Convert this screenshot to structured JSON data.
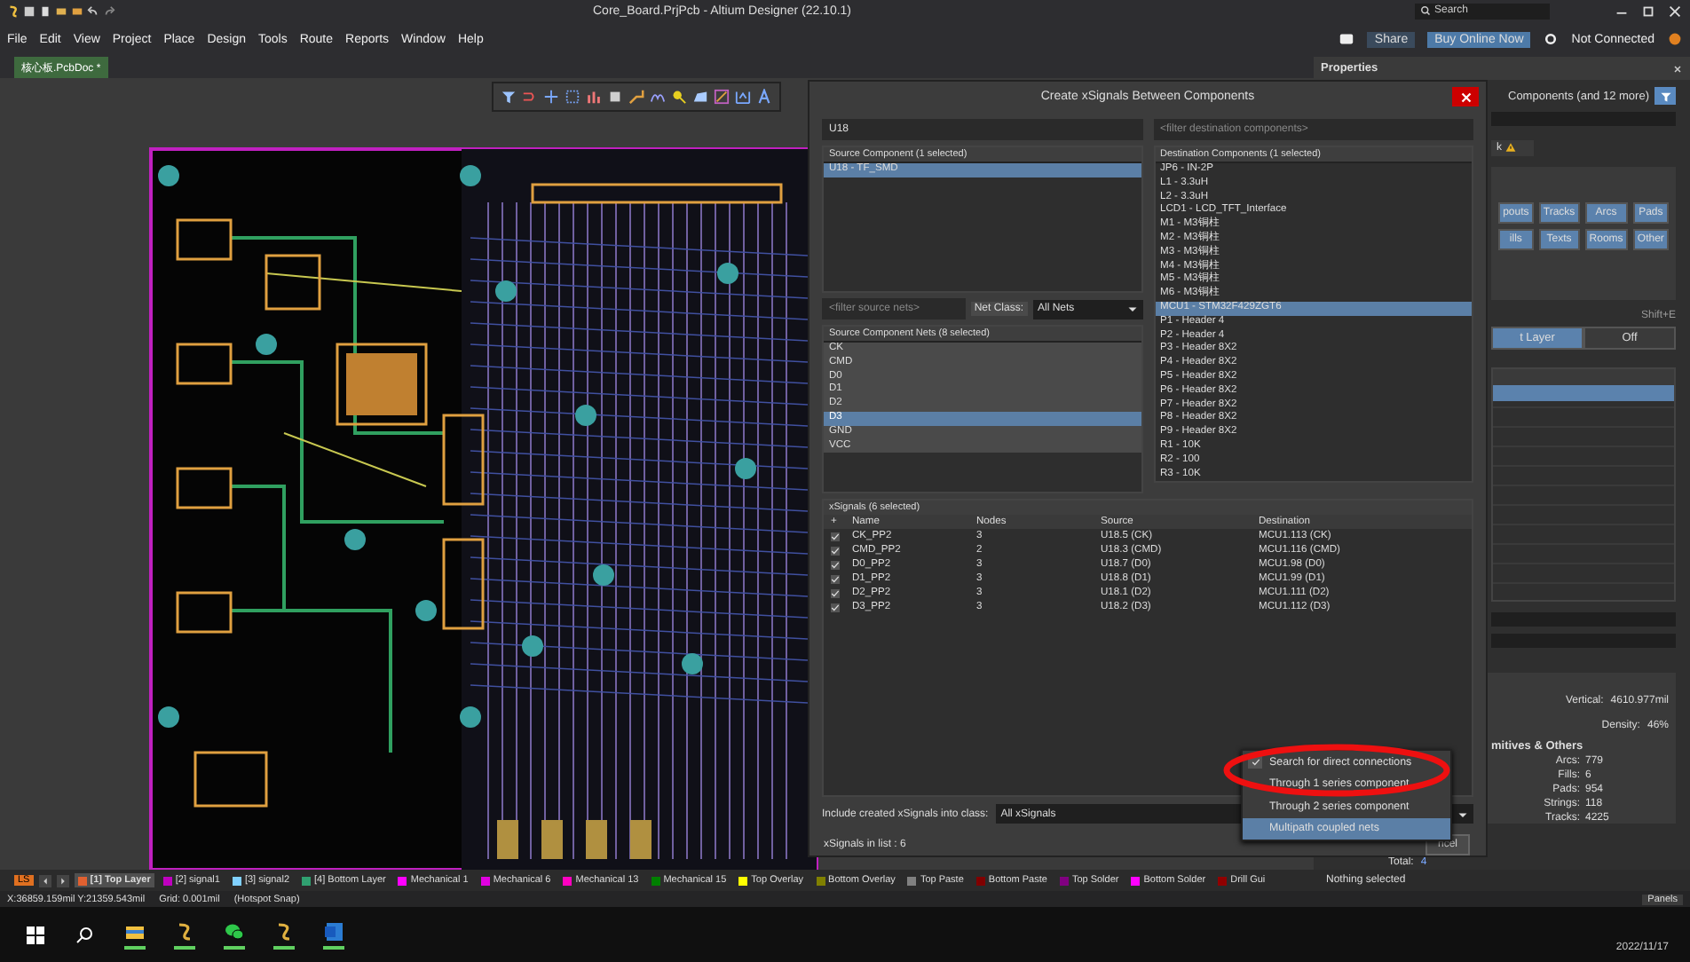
{
  "window": {
    "title": "Core_Board.PrjPcb - Altium Designer (22.10.1)",
    "search_placeholder": "Search"
  },
  "menu": [
    "File",
    "Edit",
    "View",
    "Project",
    "Place",
    "Design",
    "Tools",
    "Route",
    "Reports",
    "Window",
    "Help"
  ],
  "header_actions": {
    "share": "Share",
    "buy": "Buy Online Now",
    "connection": "Not Connected"
  },
  "document_tabs": [
    {
      "label": "核心板.PcbDoc *",
      "selected": true
    }
  ],
  "properties": {
    "title": "Properties",
    "filter": "Components (and 12 more)",
    "tab_fragment": "k",
    "object_buttons": [
      {
        "label": "pouts",
        "selected": true
      },
      {
        "label": "Tracks",
        "selected": true
      },
      {
        "label": "Arcs",
        "selected": true
      },
      {
        "label": "Pads",
        "selected": true
      },
      {
        "label": "ills",
        "selected": true
      },
      {
        "label": "Texts",
        "selected": true
      },
      {
        "label": "Rooms",
        "selected": true
      },
      {
        "label": "Other",
        "selected": true
      }
    ],
    "shortcut": "Shift+E",
    "layer_toggle": [
      {
        "label": "t Layer",
        "selected": true
      },
      {
        "label": "Off",
        "selected": false
      }
    ],
    "vertical_label": "Vertical:",
    "vertical": "4610.977mil",
    "density_label": "Density:",
    "density": "46%",
    "section": "mitives & Others",
    "stats": [
      {
        "label": "Arcs:",
        "value": "779"
      },
      {
        "label": "Fills:",
        "value": "6"
      },
      {
        "label": "Pads:",
        "value": "954"
      },
      {
        "label": "Strings:",
        "value": "118"
      },
      {
        "label": "Tracks:",
        "value": "4225"
      }
    ],
    "total_label": "Total:",
    "total": "4"
  },
  "dialog": {
    "title": "Create xSignals Between Components",
    "source_filter": "U18",
    "source_header": "Source Component (1 selected)",
    "source_components": [
      {
        "label": "U18 - TF_SMD",
        "selected": true
      }
    ],
    "nets_filter_placeholder": "<filter source nets>",
    "net_class_label": "Net Class:",
    "net_class": "All Nets",
    "nets_header": "Source Component Nets (8 selected)",
    "nets": [
      {
        "label": "CK",
        "selected": true,
        "current": false
      },
      {
        "label": "CMD",
        "selected": true,
        "current": false
      },
      {
        "label": "D0",
        "selected": true,
        "current": false
      },
      {
        "label": "D1",
        "selected": true,
        "current": false
      },
      {
        "label": "D2",
        "selected": true,
        "current": false
      },
      {
        "label": "D3",
        "selected": true,
        "current": true
      },
      {
        "label": "GND",
        "selected": true,
        "current": false
      },
      {
        "label": "VCC",
        "selected": true,
        "current": false
      }
    ],
    "dest_filter_placeholder": "<filter destination components>",
    "dest_header": "Destination Components (1 selected)",
    "destinations": [
      {
        "label": "JP6 - IN-2P",
        "selected": false
      },
      {
        "label": "L1 - 3.3uH",
        "selected": false
      },
      {
        "label": "L2 - 3.3uH",
        "selected": false
      },
      {
        "label": "LCD1 - LCD_TFT_Interface",
        "selected": false
      },
      {
        "label": "M1 - M3铜柱",
        "selected": false
      },
      {
        "label": "M2 - M3铜柱",
        "selected": false
      },
      {
        "label": "M3 - M3铜柱",
        "selected": false
      },
      {
        "label": "M4 - M3铜柱",
        "selected": false
      },
      {
        "label": "M5 - M3铜柱",
        "selected": false
      },
      {
        "label": "M6 - M3铜柱",
        "selected": false
      },
      {
        "label": "MCU1 - STM32F429ZGT6",
        "selected": true
      },
      {
        "label": "P1 - Header 4",
        "selected": false
      },
      {
        "label": "P2 - Header 4",
        "selected": false
      },
      {
        "label": "P3 - Header 8X2",
        "selected": false
      },
      {
        "label": "P4 - Header 8X2",
        "selected": false
      },
      {
        "label": "P5 - Header 8X2",
        "selected": false
      },
      {
        "label": "P6 - Header 8X2",
        "selected": false
      },
      {
        "label": "P7 - Header 8X2",
        "selected": false
      },
      {
        "label": "P8 - Header 8X2",
        "selected": false
      },
      {
        "label": "P9 - Header 8X2",
        "selected": false
      },
      {
        "label": "R1 - 10K",
        "selected": false
      },
      {
        "label": "R2 - 100",
        "selected": false
      },
      {
        "label": "R3 - 10K",
        "selected": false
      }
    ],
    "xsignals_header": "xSignals (6 selected)",
    "columns": [
      "+",
      "Name",
      "Nodes",
      "Source",
      "Destination"
    ],
    "rows": [
      {
        "checked": true,
        "name": "CK_PP2",
        "nodes": "3",
        "source": "U18.5 (CK)",
        "destination": "MCU1.113 (CK)"
      },
      {
        "checked": true,
        "name": "CMD_PP2",
        "nodes": "2",
        "source": "U18.3 (CMD)",
        "destination": "MCU1.116 (CMD)"
      },
      {
        "checked": true,
        "name": "D0_PP2",
        "nodes": "3",
        "source": "U18.7 (D0)",
        "destination": "MCU1.98 (D0)"
      },
      {
        "checked": true,
        "name": "D1_PP2",
        "nodes": "3",
        "source": "U18.8 (D1)",
        "destination": "MCU1.99 (D1)"
      },
      {
        "checked": true,
        "name": "D2_PP2",
        "nodes": "3",
        "source": "U18.1 (D2)",
        "destination": "MCU1.111 (D2)"
      },
      {
        "checked": true,
        "name": "D3_PP2",
        "nodes": "3",
        "source": "U18.2 (D3)",
        "destination": "MCU1.112 (D3)"
      }
    ],
    "class_label": "Include created xSignals into class:",
    "class_value": "All xSignals",
    "count": "xSignals in list : 6",
    "cancel": "ncel",
    "menu": [
      {
        "label": "Search for direct connections",
        "checked": true,
        "selected": false
      },
      {
        "label": "Through 1 series component",
        "checked": false,
        "selected": false
      },
      {
        "label": "Through 2 series component",
        "checked": false,
        "selected": false
      },
      {
        "label": "Multipath coupled nets",
        "checked": false,
        "selected": true
      }
    ]
  },
  "layers": {
    "set": "LS",
    "items": [
      {
        "label": "[1] Top Layer",
        "color": "#e06030",
        "selected": true
      },
      {
        "label": "[2] signal1",
        "color": "#c000c0",
        "selected": false
      },
      {
        "label": "[3] signal2",
        "color": "#80d0ff",
        "selected": false
      },
      {
        "label": "[4] Bottom Layer",
        "color": "#30a070",
        "selected": false
      },
      {
        "label": "Mechanical 1",
        "color": "#ff00ff",
        "selected": false
      },
      {
        "label": "Mechanical 6",
        "color": "#e000e0",
        "selected": false
      },
      {
        "label": "Mechanical 13",
        "color": "#ff00c0",
        "selected": false
      },
      {
        "label": "Mechanical 15",
        "color": "#008000",
        "selected": false
      },
      {
        "label": "Top Overlay",
        "color": "#ffff00",
        "selected": false
      },
      {
        "label": "Bottom Overlay",
        "color": "#808000",
        "selected": false
      },
      {
        "label": "Top Paste",
        "color": "#808080",
        "selected": false
      },
      {
        "label": "Bottom Paste",
        "color": "#800000",
        "selected": false
      },
      {
        "label": "Top Solder",
        "color": "#800080",
        "selected": false
      },
      {
        "label": "Bottom Solder",
        "color": "#ff00ff",
        "selected": false
      },
      {
        "label": "Drill Gui",
        "color": "#900000",
        "selected": false
      }
    ]
  },
  "selection": "Nothing selected",
  "status_bar": {
    "coords": "X:36859.159mil Y:21359.543mil",
    "grid": "Grid: 0.001mil",
    "snap": "(Hotspot Snap)",
    "panels": "Panels"
  },
  "taskbar": {
    "date": "2022/11/17"
  }
}
